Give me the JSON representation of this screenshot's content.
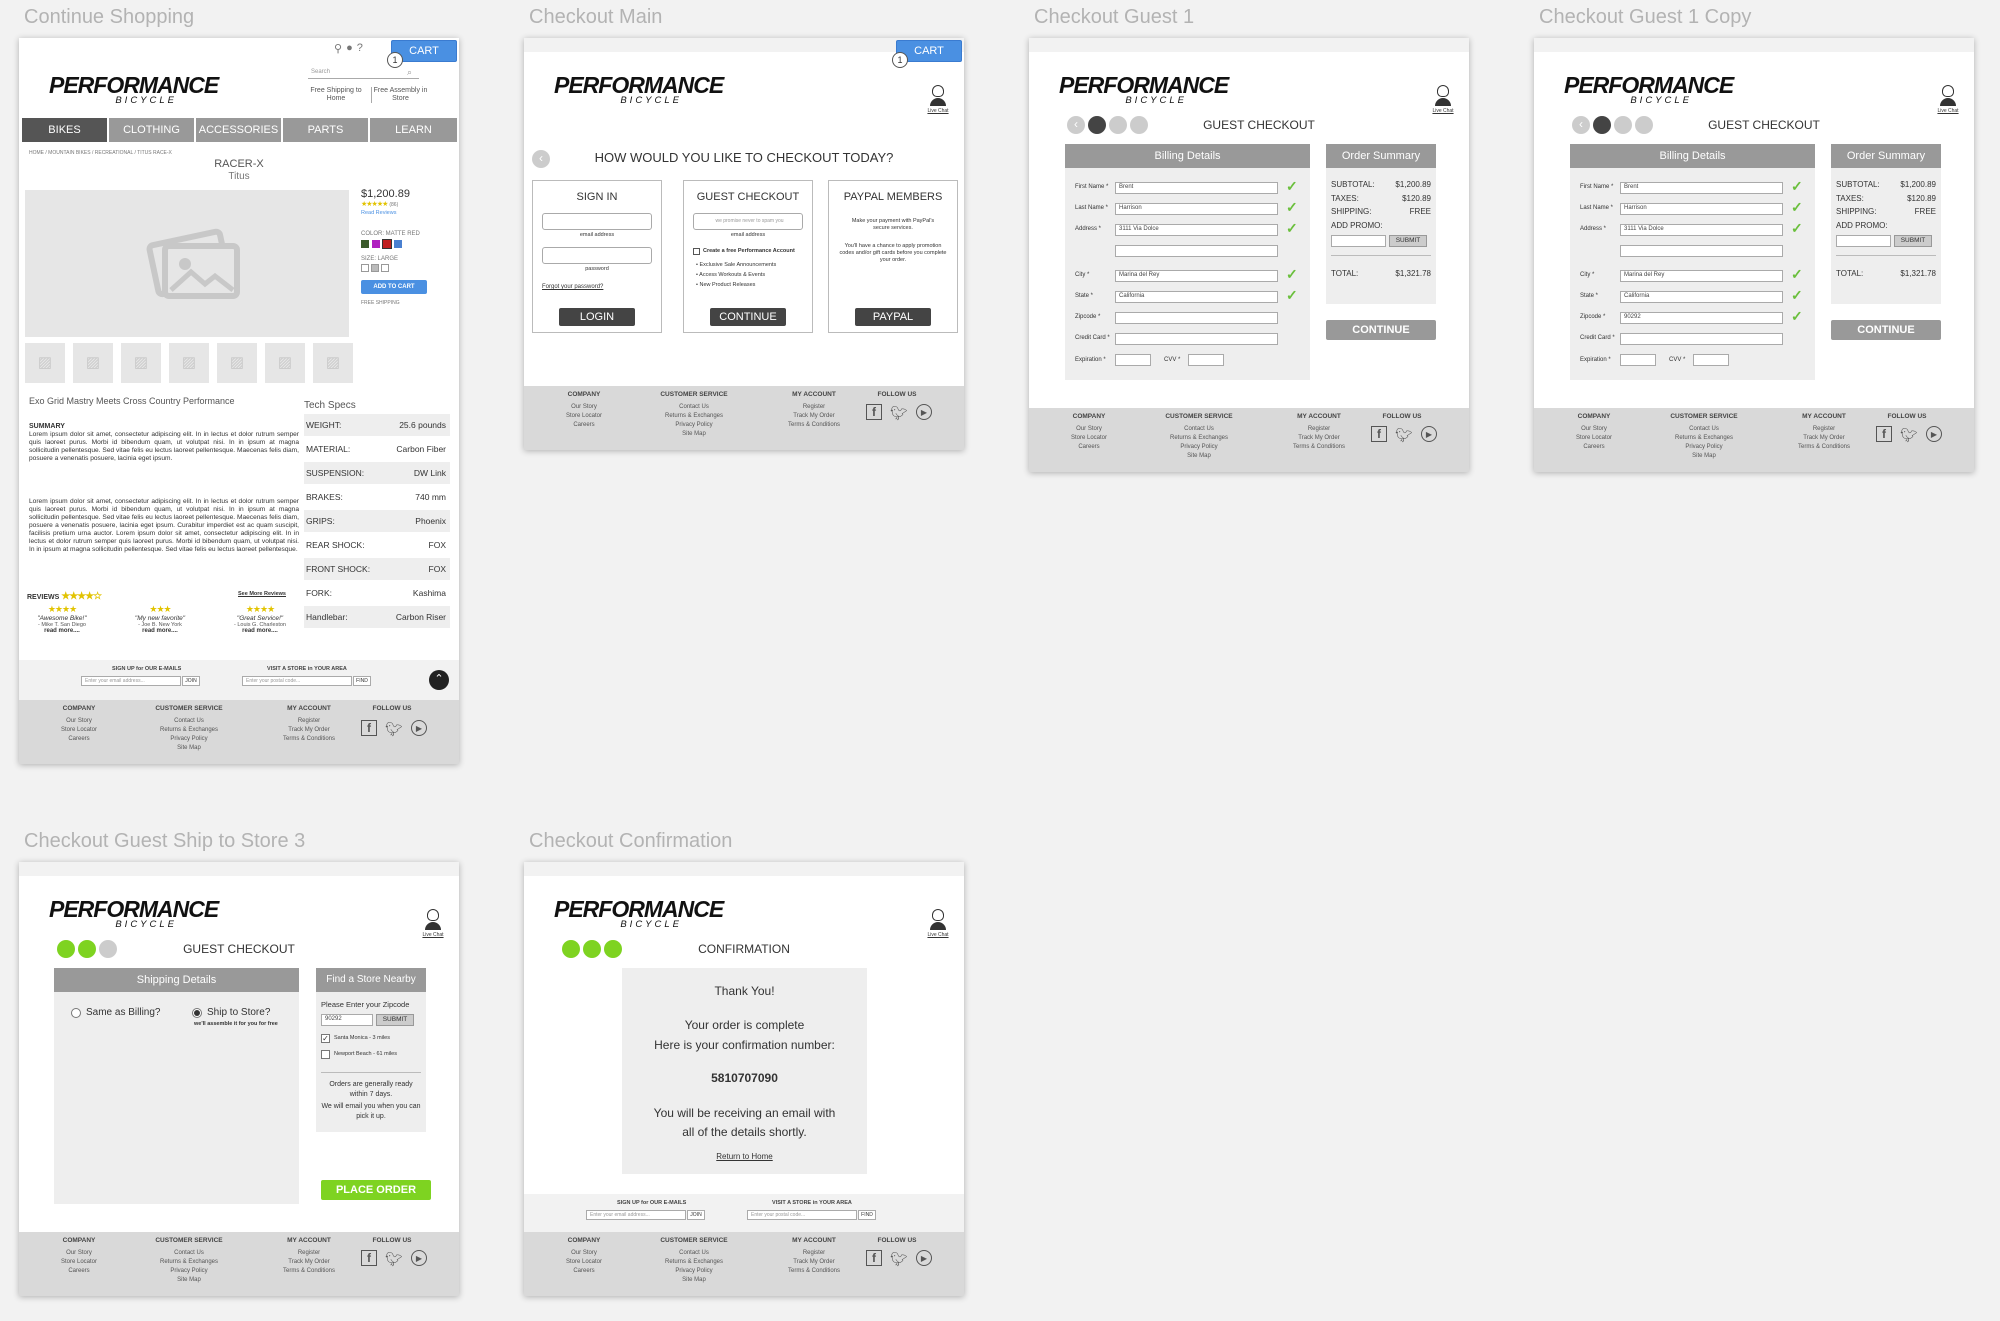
{
  "artboards": {
    "continue_shopping": "Continue Shopping",
    "checkout_main": "Checkout Main",
    "checkout_guest_1": "Checkout Guest 1",
    "checkout_guest_1_copy": "Checkout Guest 1 Copy",
    "ship_to_store": "Checkout Guest Ship to Store 3",
    "confirmation": "Checkout Confirmation"
  },
  "brand": {
    "line1": "PERFORMANCE",
    "line2": "BICYCLE"
  },
  "cart": {
    "label": "CART",
    "count": "1"
  },
  "live_chat": "Live Chat",
  "colors": {
    "accent_blue": "#4a90e2",
    "success_green": "#7ed321",
    "dark": "#444444",
    "mid_gray": "#999999"
  },
  "product": {
    "search_placeholder": "Search",
    "free_shipping": "Free Shipping to Home",
    "free_assembly": "Free Assembly in Store",
    "nav": [
      "BIKES",
      "CLOTHING",
      "ACCESSORIES",
      "PARTS",
      "LEARN"
    ],
    "breadcrumb": "HOME / MOUNTAIN BIKES / RECREATIONAL / TITUS RACE-X",
    "name": "RACER-X",
    "brand": "Titus",
    "price": "$1,200.89",
    "review_count": "(86)",
    "read_reviews": "Read Reviews",
    "color_label": "COLOR: MATTE RED",
    "size_label": "SIZE: LARGE",
    "add_to_cart": "ADD TO CART",
    "free_shipping_small": "FREE SHIPPING",
    "headline": "Exo Grid Mastry Meets Cross Country Performance",
    "summary_label": "SUMMARY",
    "summary_1": "Lorem ipsum dolor sit amet, consectetur adipiscing elit. In in lectus et dolor rutrum semper quis laoreet purus. Morbi id bibendum quam, ut volutpat nisi. In in ipsum at magna sollicitudin pellentesque. Sed vitae felis eu lectus laoreet pellentesque. Maecenas felis diam, posuere a venenatis posuere, lacinia eget ipsum.",
    "summary_2": "Lorem ipsum dolor sit amet, consectetur adipiscing elit. In in lectus et dolor rutrum semper quis laoreet purus. Morbi id bibendum quam, ut volutpat nisi. In in ipsum at magna sollicitudin pellentesque. Sed vitae felis eu lectus laoreet pellentesque. Maecenas felis diam, posuere a venenatis posuere, lacinia eget ipsum. Curabitur imperdiet est ac quam suscipit, facilisis pretium urna auctor. Lorem ipsum dolor sit amet, consectetur adipiscing elit. In in lectus et dolor rutrum semper quis laoreet purus. Morbi id bibendum quam, ut volutpat nisi. In in ipsum at magna sollicitudin pellentesque. Sed vitae felis eu lectus laoreet pellentesque.",
    "reviews_label": "REVIEWS",
    "see_more_reviews": "See More Reviews",
    "reviews": [
      {
        "quote": "\"Awesome Bike!\"",
        "author": "- Mike T. San Diego",
        "more": "read more...."
      },
      {
        "quote": "\"My new favorite\"",
        "author": "- Joe B. New York",
        "more": "read more...."
      },
      {
        "quote": "\"Great Service!\"",
        "author": "- Louis G. Charleston",
        "more": "read more...."
      }
    ],
    "tech_specs_label": "Tech Specs",
    "specs": [
      {
        "k": "WEIGHT:",
        "v": "25.6 pounds"
      },
      {
        "k": "MATERIAL:",
        "v": "Carbon Fiber"
      },
      {
        "k": "SUSPENSION:",
        "v": "DW Link"
      },
      {
        "k": "BRAKES:",
        "v": "740 mm"
      },
      {
        "k": "GRIPS:",
        "v": "Phoenix"
      },
      {
        "k": "REAR SHOCK:",
        "v": "FOX"
      },
      {
        "k": "FRONT SHOCK:",
        "v": "FOX"
      },
      {
        "k": "FORK:",
        "v": "Kashima"
      },
      {
        "k": "Handlebar:",
        "v": "Carbon Riser"
      }
    ]
  },
  "signup": {
    "signup_label": "SIGN UP for OUR E-MAILS",
    "email_placeholder": "Enter your email address...",
    "join": "JOIN",
    "store_label": "VISIT A STORE in YOUR AREA",
    "postal_placeholder": "Enter your postal code...",
    "find": "FIND"
  },
  "footer": {
    "company": {
      "heading": "COMPANY",
      "links": [
        "Our Story",
        "Store Locator",
        "Careers"
      ]
    },
    "service": {
      "heading": "CUSTOMER SERVICE",
      "links": [
        "Contact Us",
        "Returns & Exchanges",
        "Privacy Policy",
        "Site Map"
      ]
    },
    "account": {
      "heading": "MY ACCOUNT",
      "links": [
        "Register",
        "Track My Order",
        "Terms & Conditions"
      ]
    },
    "follow": {
      "heading": "FOLLOW US"
    }
  },
  "checkout_main": {
    "question": "HOW WOULD YOU LIKE TO CHECKOUT TODAY?",
    "signin": {
      "title": "SIGN IN",
      "email_label": "email address",
      "password_label": "password",
      "forgot": "Forgot your password?",
      "button": "LOGIN"
    },
    "guest": {
      "title": "GUEST CHECKOUT",
      "email_placeholder": "we promise never to spam you",
      "email_label": "email address",
      "create_account": "Create a free Performance Account",
      "perks": [
        "Exclusive Sale Announcements",
        "Access Workouts & Events",
        "New Product Releases"
      ],
      "button": "CONTINUE"
    },
    "paypal": {
      "title": "PAYPAL MEMBERS",
      "text1": "Make your payment with PayPal's secure services.",
      "text2": "You'll have a chance to apply promotion codes and/or gift cards before you complete your order.",
      "button": "PAYPAL"
    }
  },
  "guest_checkout": {
    "title": "GUEST CHECKOUT",
    "billing_header": "Billing Details",
    "fields": [
      {
        "label": "First Name *",
        "value": "Brent"
      },
      {
        "label": "Last Name *",
        "value": "Harrison"
      },
      {
        "label": "Address *",
        "value": "3111 Via Dolce"
      },
      {
        "label": "",
        "value": ""
      },
      {
        "label": "City *",
        "value": "Marina del Rey"
      },
      {
        "label": "State *",
        "value": "California"
      },
      {
        "label": "Zipcode *",
        "value": ""
      },
      {
        "label": "Credit Card *",
        "value": ""
      }
    ],
    "zip_value_copy": "90292",
    "expiration_label": "Expiration *",
    "cvv_label": "CVV *",
    "summary_header": "Order Summary",
    "subtotal_label": "SUBTOTAL:",
    "subtotal": "$1,200.89",
    "taxes_label": "TAXES:",
    "taxes": "$120.89",
    "shipping_label": "SHIPPING:",
    "shipping": "FREE",
    "promo_label": "ADD PROMO:",
    "submit": "SUBMIT",
    "total_label": "TOTAL:",
    "total": "$1,321.78",
    "continue": "CONTINUE"
  },
  "ship_to_store": {
    "title": "GUEST CHECKOUT",
    "shipping_header": "Shipping Details",
    "same_as_billing": "Same as Billing?",
    "ship_to_store": "Ship to Store?",
    "assemble_note": "we'll assemble it for you for free",
    "find_store_header": "Find a Store Nearby",
    "enter_zip": "Please Enter your Zipcode",
    "zip_value": "90292",
    "submit": "SUBMIT",
    "stores": [
      "Santa Monica - 3 miles",
      "Newport Beach - 61 miles"
    ],
    "ready_note": "Orders are generally ready within 7 days.",
    "email_note": "We will email you when you can pick it up.",
    "place_order": "PLACE ORDER"
  },
  "confirmation": {
    "title": "CONFIRMATION",
    "thank_you": "Thank You!",
    "complete": "Your order is complete",
    "here_is": "Here is your confirmation number:",
    "number": "5810707090",
    "email_1": "You will be receiving an email with",
    "email_2": "all of the details shortly.",
    "return": "Return to Home"
  }
}
